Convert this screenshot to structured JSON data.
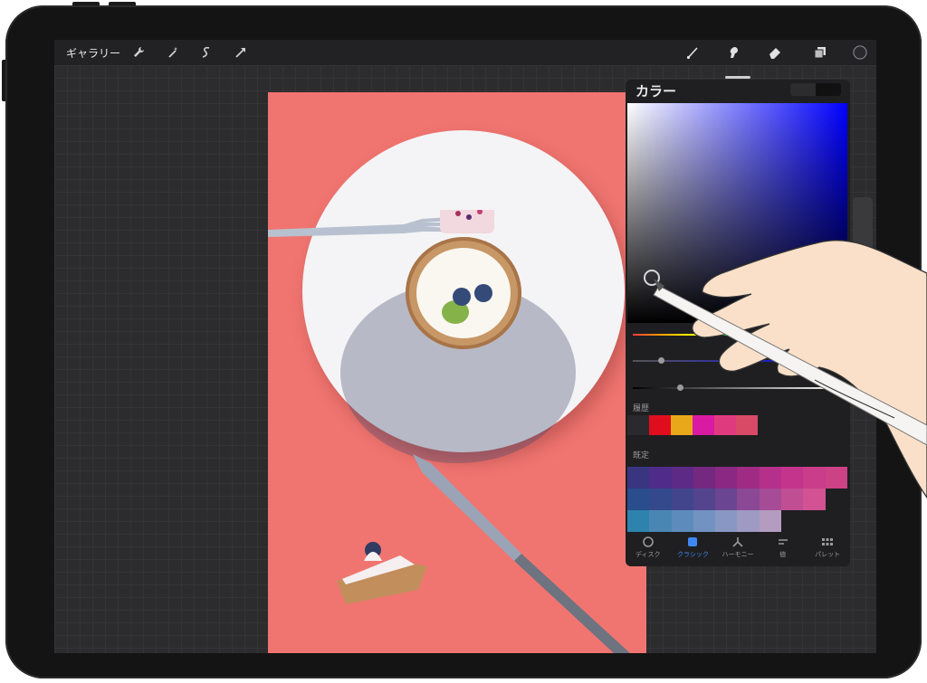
{
  "app": {
    "gallery_label": "ギャラリー",
    "left_tools": [
      "wrench-icon",
      "magic-wand-icon",
      "selection-icon",
      "transform-arrow-icon"
    ],
    "right_tools": [
      "brush-icon",
      "smudge-icon",
      "eraser-icon",
      "layers-icon",
      "color-dot-icon"
    ],
    "current_color": "#2a2a2e"
  },
  "canvas": {
    "background_color": "#f07570",
    "image_description_tag": ""
  },
  "color_panel": {
    "title": "カラー",
    "hue_color": "#0000ff",
    "history_label": "履歴",
    "history_colors": [
      "#2a2a2e",
      "#e00d1e",
      "#e8a81a",
      "#d91aa3",
      "#e03a7e",
      "#d84a66"
    ],
    "default_label": "既定",
    "palette_rows": [
      [
        "#3a3580",
        "#4f2c8a",
        "#5d2a86",
        "#74287f",
        "#8a2883",
        "#a02b84",
        "#b5308a",
        "#c4348d",
        "#c93d8a",
        "#cc4285"
      ],
      [
        "#2a4d8e",
        "#33498c",
        "#43458c",
        "#53448d",
        "#6a4591",
        "#8b4894",
        "#a64b95",
        "#c04e93",
        "#d25293"
      ],
      [
        "#2d83ad",
        "#4a86b4",
        "#5d8cbc",
        "#7293c1",
        "#8897c3",
        "#9e9ac3",
        "#b39cbf"
      ]
    ],
    "tabs": [
      {
        "icon": "disc-icon",
        "label": "ディスク"
      },
      {
        "icon": "classic-icon",
        "label": "クラシック"
      },
      {
        "icon": "harmony-icon",
        "label": "ハーモニー"
      },
      {
        "icon": "value-icon",
        "label": "値"
      },
      {
        "icon": "palette-icon",
        "label": "パレット"
      }
    ],
    "active_tab": 1,
    "sliders": [
      {
        "name": "hue",
        "value": 0.85
      },
      {
        "name": "saturation",
        "value": 0.13
      },
      {
        "name": "brightness",
        "value": 0.22
      }
    ]
  }
}
